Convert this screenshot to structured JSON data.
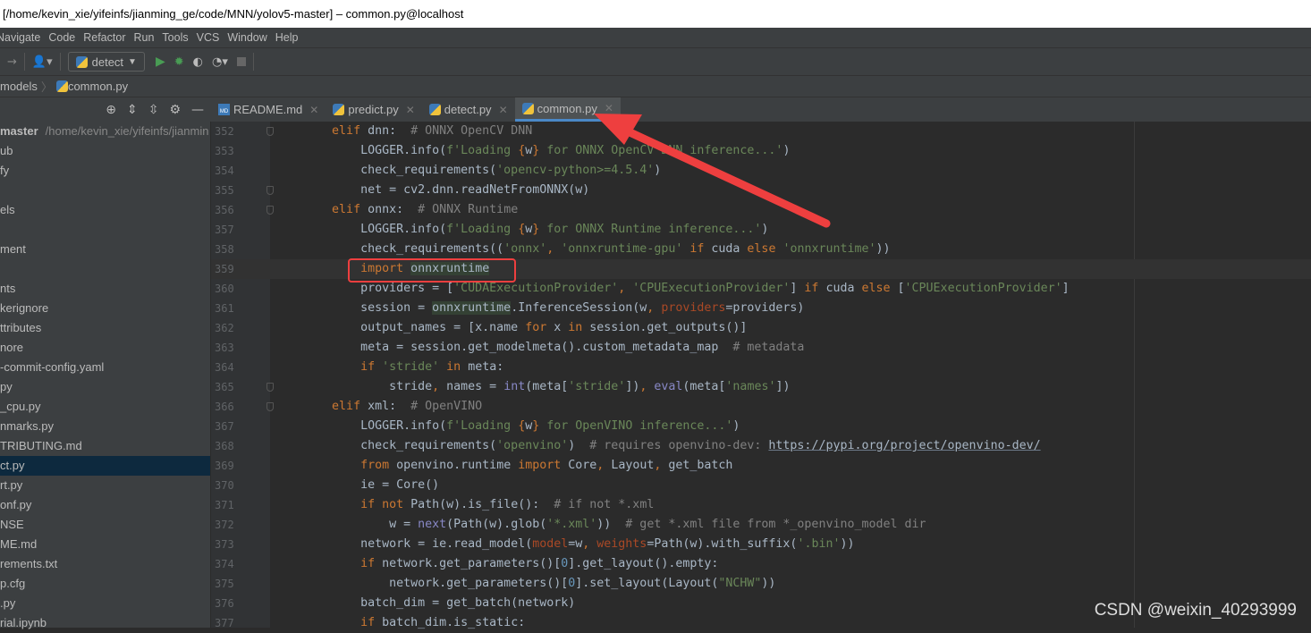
{
  "window": {
    "title": "[/home/kevin_xie/yifeinfs/jianming_ge/code/MNN/yolov5-master] – common.py@localhost"
  },
  "menu": [
    "Navigate",
    "Code",
    "Refactor",
    "Run",
    "Tools",
    "VCS",
    "Window",
    "Help"
  ],
  "toolbar": {
    "run_config": "detect",
    "icons": [
      "forward-arrow-icon",
      "user-icon",
      "run-icon",
      "debug-icon",
      "coverage-icon",
      "profile-icon",
      "stop-icon"
    ]
  },
  "breadcrumb": {
    "items": [
      "models",
      "common.py"
    ]
  },
  "sidebar": {
    "project_name": "master",
    "project_path": "/home/kevin_xie/yifeinfs/jianmin",
    "items": [
      "ub",
      "fy",
      "",
      "els",
      "",
      "ment",
      "",
      "nts",
      "kerignore",
      "ttributes",
      "nore",
      "-commit-config.yaml",
      "py",
      "_cpu.py",
      "nmarks.py",
      "TRIBUTING.md",
      "ct.py",
      "rt.py",
      "onf.py",
      "NSE",
      "ME.md",
      "rements.txt",
      "p.cfg",
      ".py",
      "rial.ipynb"
    ],
    "selected_index": 16
  },
  "tabs": [
    {
      "label": "README.md",
      "icon": "markdown"
    },
    {
      "label": "predict.py",
      "icon": "python"
    },
    {
      "label": "detect.py",
      "icon": "python"
    },
    {
      "label": "common.py",
      "icon": "python",
      "active": true
    }
  ],
  "editor": {
    "current_line": 359,
    "lines": [
      {
        "n": 352,
        "t": [
          [
            "",
            "        "
          ],
          [
            "kw",
            "elif"
          ],
          [
            "",
            " dnn:  "
          ],
          [
            "cmt",
            "# ONNX OpenCV DNN"
          ]
        ]
      },
      {
        "n": 353,
        "t": [
          [
            "",
            "            LOGGER.info("
          ],
          [
            "str",
            "f'Loading "
          ],
          [
            "kw",
            "{"
          ],
          [
            "",
            "w"
          ],
          [
            "kw",
            "}"
          ],
          [
            "str",
            " for ONNX OpenCV DNN inference...'"
          ],
          [
            "",
            ")"
          ]
        ]
      },
      {
        "n": 354,
        "t": [
          [
            "",
            "            check_requirements("
          ],
          [
            "str",
            "'opencv-python>=4.5.4'"
          ],
          [
            "",
            ")"
          ]
        ]
      },
      {
        "n": 355,
        "t": [
          [
            "",
            "            net = cv2.dnn.readNetFromONNX(w)"
          ]
        ]
      },
      {
        "n": 356,
        "t": [
          [
            "",
            "        "
          ],
          [
            "kw",
            "elif"
          ],
          [
            "",
            " onnx:  "
          ],
          [
            "cmt",
            "# ONNX Runtime"
          ]
        ]
      },
      {
        "n": 357,
        "t": [
          [
            "",
            "            LOGGER.info("
          ],
          [
            "str",
            "f'Loading "
          ],
          [
            "kw",
            "{"
          ],
          [
            "",
            "w"
          ],
          [
            "kw",
            "}"
          ],
          [
            "str",
            " for ONNX Runtime inference...'"
          ],
          [
            "",
            ")"
          ]
        ]
      },
      {
        "n": 358,
        "t": [
          [
            "",
            "            check_requirements(("
          ],
          [
            "str",
            "'onnx'"
          ],
          [
            "kw",
            ", "
          ],
          [
            "str",
            "'onnxruntime-gpu'"
          ],
          [
            "kw",
            " if"
          ],
          [
            "",
            " cuda "
          ],
          [
            "kw",
            "else"
          ],
          [
            "",
            " "
          ],
          [
            "str",
            "'onnxruntime'"
          ],
          [
            "",
            "))"
          ]
        ]
      },
      {
        "n": 359,
        "t": [
          [
            "",
            "            "
          ],
          [
            "kw",
            "import"
          ],
          [
            "",
            " "
          ],
          [
            "mod",
            "onnxruntime"
          ]
        ]
      },
      {
        "n": 360,
        "t": [
          [
            "",
            "            providers = ["
          ],
          [
            "str",
            "'CUDAExecutionProvider'"
          ],
          [
            "kw",
            ", "
          ],
          [
            "str",
            "'CPUExecutionProvider'"
          ],
          [
            "",
            "] "
          ],
          [
            "kw",
            "if"
          ],
          [
            "",
            " cuda "
          ],
          [
            "kw",
            "else"
          ],
          [
            "",
            " ["
          ],
          [
            "str",
            "'CPUExecutionProvider'"
          ],
          [
            "",
            "]"
          ]
        ]
      },
      {
        "n": 361,
        "t": [
          [
            "",
            "            session = "
          ],
          [
            "mod",
            "onnxruntime"
          ],
          [
            "",
            ".InferenceSession(w"
          ],
          [
            "kw",
            ", "
          ],
          [
            "prm",
            "providers"
          ],
          [
            "",
            "=providers)"
          ]
        ]
      },
      {
        "n": 362,
        "t": [
          [
            "",
            "            output_names = [x.name "
          ],
          [
            "kw",
            "for"
          ],
          [
            "",
            " x "
          ],
          [
            "kw",
            "in"
          ],
          [
            "",
            " session.get_outputs()]"
          ]
        ]
      },
      {
        "n": 363,
        "t": [
          [
            "",
            "            meta = session.get_modelmeta().custom_metadata_map  "
          ],
          [
            "cmt",
            "# metadata"
          ]
        ]
      },
      {
        "n": 364,
        "t": [
          [
            "",
            "            "
          ],
          [
            "kw",
            "if"
          ],
          [
            "",
            " "
          ],
          [
            "str",
            "'stride'"
          ],
          [
            "kw",
            " in"
          ],
          [
            "",
            " meta:"
          ]
        ]
      },
      {
        "n": 365,
        "t": [
          [
            "",
            "                stride"
          ],
          [
            "kw",
            ", "
          ],
          [
            "",
            "names = "
          ],
          [
            "bi",
            "int"
          ],
          [
            "",
            "(meta["
          ],
          [
            "str",
            "'stride'"
          ],
          [
            "",
            "])"
          ],
          [
            "kw",
            ", "
          ],
          [
            "bi",
            "eval"
          ],
          [
            "",
            "(meta["
          ],
          [
            "str",
            "'names'"
          ],
          [
            "",
            "])"
          ]
        ]
      },
      {
        "n": 366,
        "t": [
          [
            "",
            "        "
          ],
          [
            "kw",
            "elif"
          ],
          [
            "",
            " xml:  "
          ],
          [
            "cmt",
            "# OpenVINO"
          ]
        ]
      },
      {
        "n": 367,
        "t": [
          [
            "",
            "            LOGGER.info("
          ],
          [
            "str",
            "f'Loading "
          ],
          [
            "kw",
            "{"
          ],
          [
            "",
            "w"
          ],
          [
            "kw",
            "}"
          ],
          [
            "str",
            " for OpenVINO inference...'"
          ],
          [
            "",
            ")"
          ]
        ]
      },
      {
        "n": 368,
        "t": [
          [
            "",
            "            check_requirements("
          ],
          [
            "str",
            "'openvino'"
          ],
          [
            "",
            ")  "
          ],
          [
            "cmt",
            "# requires openvino-dev: "
          ],
          [
            "url",
            "https://pypi.org/project/openvino-dev/"
          ]
        ]
      },
      {
        "n": 369,
        "t": [
          [
            "",
            "            "
          ],
          [
            "kw",
            "from"
          ],
          [
            "",
            " openvino.runtime "
          ],
          [
            "kw",
            "import"
          ],
          [
            "",
            " Core"
          ],
          [
            "kw",
            ", "
          ],
          [
            "",
            "Layout"
          ],
          [
            "kw",
            ", "
          ],
          [
            "",
            "get_batch"
          ]
        ]
      },
      {
        "n": 370,
        "t": [
          [
            "",
            "            ie = Core()"
          ]
        ]
      },
      {
        "n": 371,
        "t": [
          [
            "",
            "            "
          ],
          [
            "kw",
            "if not"
          ],
          [
            "",
            " Path(w).is_file():  "
          ],
          [
            "cmt",
            "# if not *.xml"
          ]
        ]
      },
      {
        "n": 372,
        "t": [
          [
            "",
            "                w = "
          ],
          [
            "bi",
            "next"
          ],
          [
            "",
            "(Path(w).glob("
          ],
          [
            "str",
            "'*.xml'"
          ],
          [
            "",
            "))  "
          ],
          [
            "cmt",
            "# get *.xml file from *_openvino_model dir"
          ]
        ]
      },
      {
        "n": 373,
        "t": [
          [
            "",
            "            network = ie.read_model("
          ],
          [
            "prm",
            "model"
          ],
          [
            "",
            "=w"
          ],
          [
            "kw",
            ", "
          ],
          [
            "prm",
            "weights"
          ],
          [
            "",
            "=Path(w).with_suffix("
          ],
          [
            "str",
            "'.bin'"
          ],
          [
            "",
            "))"
          ]
        ]
      },
      {
        "n": 374,
        "t": [
          [
            "",
            "            "
          ],
          [
            "kw",
            "if"
          ],
          [
            "",
            " network.get_parameters()["
          ],
          [
            "num",
            "0"
          ],
          [
            "",
            "].get_layout().empty:"
          ]
        ]
      },
      {
        "n": 375,
        "t": [
          [
            "",
            "                network.get_parameters()["
          ],
          [
            "num",
            "0"
          ],
          [
            "",
            "].set_layout(Layout("
          ],
          [
            "str",
            "\"NCHW\""
          ],
          [
            "",
            "))"
          ]
        ]
      },
      {
        "n": 376,
        "t": [
          [
            "",
            "            batch_dim = get_batch(network)"
          ]
        ]
      },
      {
        "n": 377,
        "t": [
          [
            "",
            "            "
          ],
          [
            "kw",
            "if"
          ],
          [
            "",
            " batch_dim.is_static:"
          ]
        ]
      }
    ]
  },
  "annotation": {
    "color": "#ee3f3f"
  },
  "watermark": "CSDN @weixin_40293999"
}
